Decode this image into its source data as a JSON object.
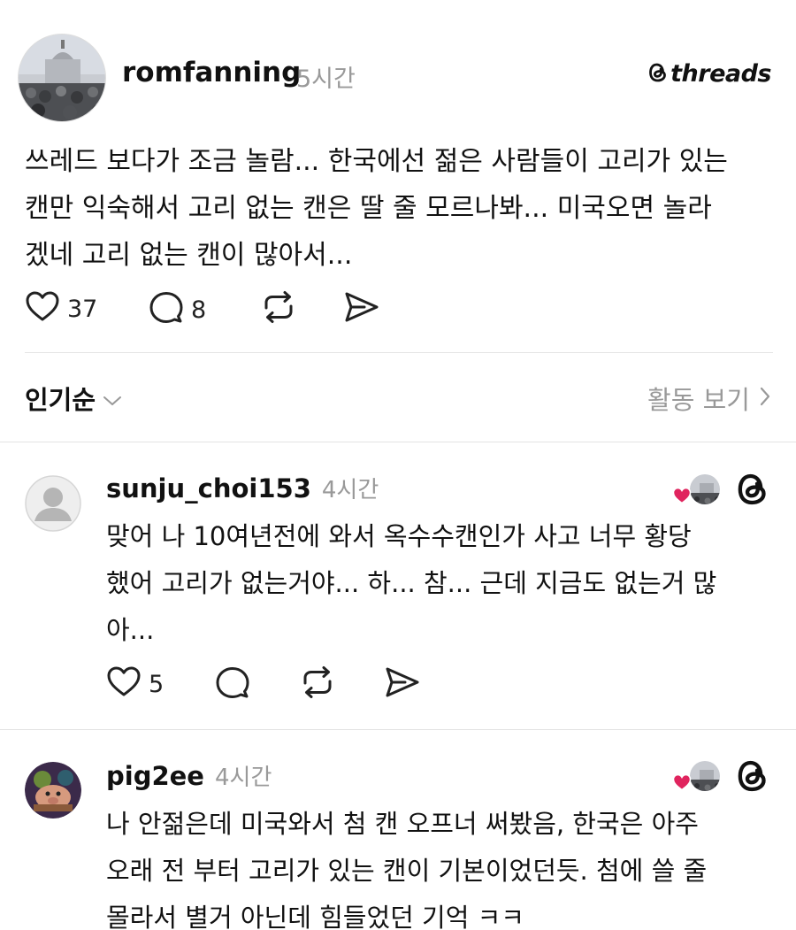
{
  "post": {
    "username": "romfanning",
    "time": "5시간",
    "brand": "threads",
    "lines": [
      "쓰레드 보다가 조금 놀람... 한국에선 젊은 사람들이 고리가 있는",
      "캔만 익숙해서 고리 없는 캔은 딸 줄 모르나봐... 미국오면 놀라",
      "겠네 고리 없는 캔이 많아서..."
    ],
    "likes": "37",
    "comments": "8"
  },
  "sort": {
    "label": "인기순",
    "activity_label": "활동 보기"
  },
  "replies": [
    {
      "username": "sunju_choi153",
      "time": "4시간",
      "lines": [
        "맞어 나 10여년전에 와서 옥수수캔인가 사고 너무 황당",
        "했어 고리가 없는거야... 하... 참... 근데 지금도 없는거 많",
        "아..."
      ],
      "likes": "5"
    },
    {
      "username": "pig2ee",
      "time": "4시간",
      "lines": [
        "나 안젊은데 미국와서 첨 캔 오프너 써봤음, 한국은 아주",
        "오래 전 부터 고리가 있는 캔이 기본이었던듯. 첨에 쓸 줄",
        "몰라서 별거 아닌데 힘들었던 기억 ㅋㅋ"
      ]
    }
  ],
  "colors": {
    "text": "#111111",
    "muted": "#999999",
    "divider": "#e4e4e4",
    "heart": "#e0245e"
  }
}
